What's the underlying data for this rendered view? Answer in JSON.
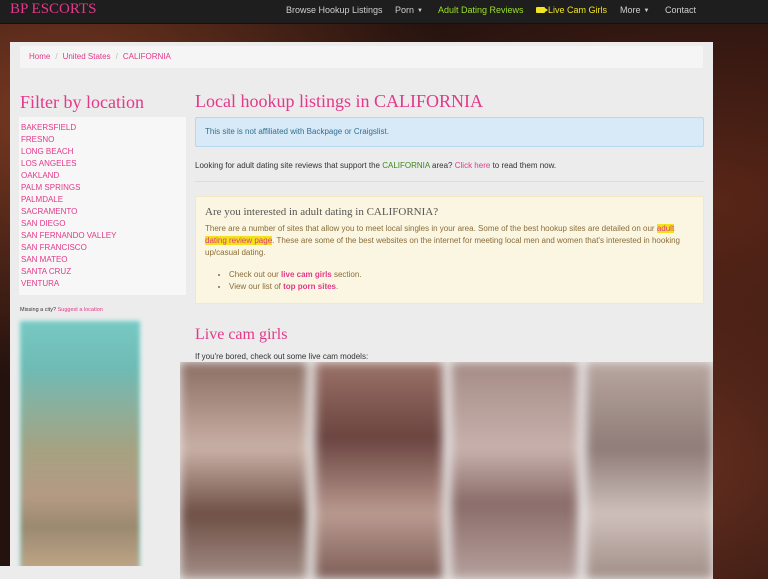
{
  "navbar": {
    "brand": "BP ESCORTS",
    "items": [
      {
        "label": "Browse Hookup Listings"
      },
      {
        "label": "Porn"
      },
      {
        "label": "Adult Dating Reviews"
      },
      {
        "label": "Live Cam Girls"
      },
      {
        "label": "More"
      },
      {
        "label": "Contact"
      }
    ]
  },
  "breadcrumb": [
    "Home",
    "United States",
    "CALIFORNIA"
  ],
  "sidebar": {
    "title": "Filter by location",
    "locations": [
      "BAKERSFIELD",
      "FRESNO",
      "LONG BEACH",
      "LOS ANGELES",
      "OAKLAND",
      "PALM SPRINGS",
      "PALMDALE",
      "SACRAMENTO",
      "SAN DIEGO",
      "SAN FERNANDO VALLEY",
      "SAN FRANCISCO",
      "SAN MATEO",
      "SANTA CRUZ",
      "VENTURA"
    ],
    "missing_text": "Missing a city?",
    "suggest_link": "Suggest a location"
  },
  "main": {
    "title": "Local hookup listings in CALIFORNIA",
    "info_alert": "This site is not affiliated with Backpage or Craigslist.",
    "reviews_prefix": "Looking for adult dating site reviews that support the",
    "reviews_state": "CALIFORNIA",
    "reviews_mid": "area?",
    "reviews_link": "Click here",
    "reviews_suffix": "to read them now.",
    "panel": {
      "heading": "Are you interested in adult dating in CALIFORNIA?",
      "text_1": "There are a number of sites that allow you to meet local singles in your area. Some of the best hookup sites are detailed on our",
      "text_link": "adult dating review page",
      "text_2": ". These are some of the best websites on the internet for meeting local men and women that's interested in hooking up/casual dating.",
      "bullet_1_prefix": "Check out our",
      "bullet_1_link": "live cam girls",
      "bullet_1_suffix": "section.",
      "bullet_2_prefix": "View our list of",
      "bullet_2_link": "top porn sites",
      "bullet_2_suffix": "."
    },
    "cam_title": "Live cam girls",
    "cam_subtitle": "If you're bored, check out some live cam models:"
  },
  "colors": {
    "accent": "#e4388a",
    "nav_green": "#9be02a",
    "nav_yellow": "#f3e320"
  }
}
